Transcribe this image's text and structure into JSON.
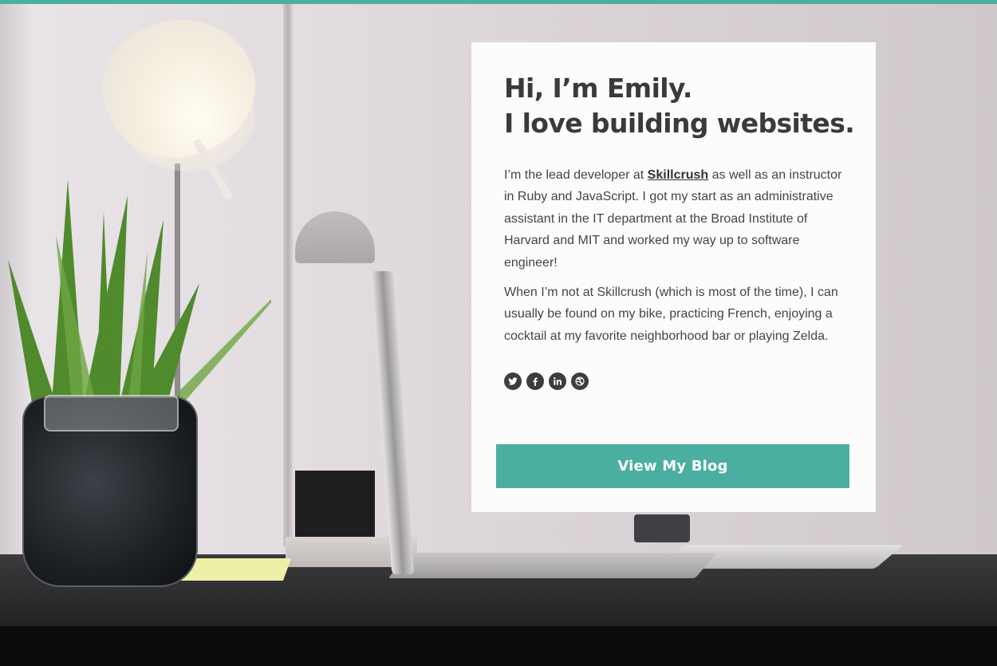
{
  "colors": {
    "accent": "#4aafa0",
    "text_dark": "#3a3a3a",
    "card_bg": "#ffffff"
  },
  "card": {
    "headline_line1": "Hi, I’m Emily.",
    "headline_line2": "I love building websites.",
    "bio1_before": "I’m the lead developer at ",
    "bio1_link": "Skillcrush",
    "bio1_after": " as well as an instructor in Ruby and JavaScript. I got my start as an administrative assistant in the IT department at the Broad Institute of Harvard and MIT and worked my way up to software engineer!",
    "bio2": "When I’m not at Skillcrush (which is most of the time), I can usually be found on my bike, practicing French, enjoying a cocktail at my favorite neighborhood bar or playing Zelda.",
    "social": [
      {
        "icon": "twitter-icon"
      },
      {
        "icon": "facebook-icon"
      },
      {
        "icon": "linkedin-icon"
      },
      {
        "icon": "dribbble-icon"
      }
    ],
    "cta_label": "View My Blog"
  }
}
